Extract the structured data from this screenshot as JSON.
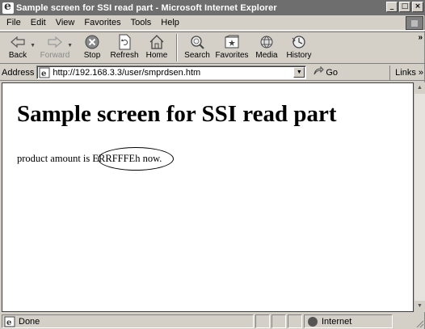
{
  "window": {
    "title": "Sample screen for SSI read part - Microsoft Internet Explorer",
    "controls": [
      "minimize",
      "maximize",
      "close"
    ]
  },
  "menu": {
    "items": [
      {
        "label": "File"
      },
      {
        "label": "Edit"
      },
      {
        "label": "View"
      },
      {
        "label": "Favorites"
      },
      {
        "label": "Tools"
      },
      {
        "label": "Help"
      }
    ]
  },
  "toolbar": {
    "back": "Back",
    "forward": "Forward",
    "stop": "Stop",
    "refresh": "Refresh",
    "home": "Home",
    "search": "Search",
    "favorites": "Favorites",
    "media": "Media",
    "history": "History",
    "overflow": "»"
  },
  "address": {
    "label": "Address",
    "url": "http://192.168.3.3/user/smprdsen.htm",
    "go": "Go",
    "links": "Links »"
  },
  "page": {
    "heading": "Sample screen for SSI read part",
    "text_before": "product amount is ",
    "value": "ERRFFFEh",
    "text_after": " now."
  },
  "status": {
    "text": "Done",
    "zone": "Internet"
  },
  "icons": {
    "app": "ie-logo-icon",
    "back": "back-arrow-icon",
    "forward": "forward-arrow-icon",
    "stop": "stop-icon",
    "refresh": "refresh-icon",
    "home": "home-icon",
    "search": "search-icon",
    "favorites": "favorites-icon",
    "media": "media-icon",
    "history": "history-icon",
    "go": "go-arrow-icon",
    "zone": "globe-icon"
  }
}
